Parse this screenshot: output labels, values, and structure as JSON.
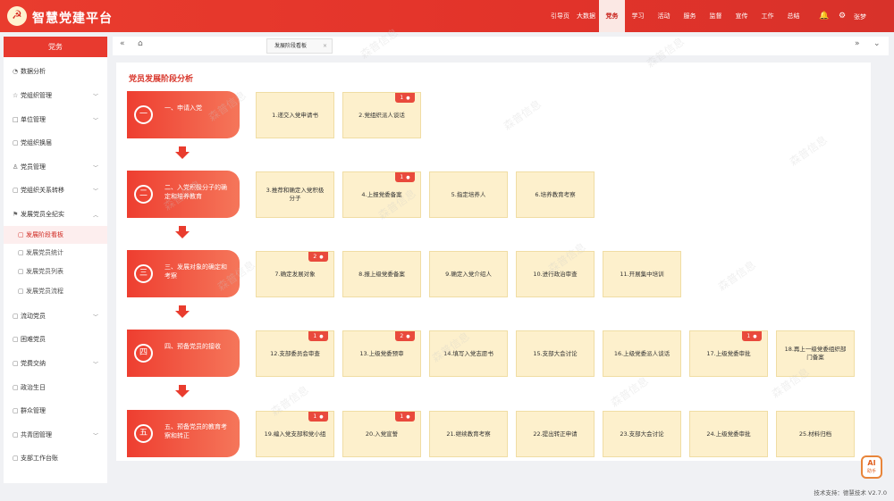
{
  "header": {
    "app_title": "智慧党建平台",
    "nav": [
      "引导页",
      "大数据",
      "党务",
      "学习",
      "活动",
      "服务",
      "监督",
      "宣传",
      "工作",
      "总结"
    ],
    "active_nav": "党务",
    "user_name": "张梦",
    "brand_color": "#e2332a"
  },
  "sidebar": {
    "title": "党务",
    "items": [
      {
        "label": "数据分析",
        "icon": "chart-icon",
        "chevron": false
      },
      {
        "label": "党组织管理",
        "icon": "star-icon",
        "chevron": true
      },
      {
        "label": "单位管理",
        "icon": "building-icon",
        "chevron": true
      },
      {
        "label": "党组织换届",
        "icon": "document-icon",
        "chevron": false
      },
      {
        "label": "党员管理",
        "icon": "user-icon",
        "chevron": true
      },
      {
        "label": "党组织关系转移",
        "icon": "transfer-icon",
        "chevron": true
      },
      {
        "label": "发展党员全纪实",
        "icon": "flag-icon",
        "chevron": true,
        "expanded": true
      },
      {
        "label": "发展阶段看板",
        "icon": "board-icon",
        "sub": true,
        "active": true
      },
      {
        "label": "发展党员统计",
        "icon": "stats-icon",
        "sub": true
      },
      {
        "label": "发展党员列表",
        "icon": "list-icon",
        "sub": true
      },
      {
        "label": "发展党员流程",
        "icon": "flow-icon",
        "sub": true
      },
      {
        "label": "流动党员",
        "icon": "people-icon",
        "chevron": true
      },
      {
        "label": "困难党员",
        "icon": "heart-icon",
        "chevron": false
      },
      {
        "label": "党费交纳",
        "icon": "wallet-icon",
        "chevron": true
      },
      {
        "label": "政治生日",
        "icon": "cake-icon",
        "chevron": false
      },
      {
        "label": "群众管理",
        "icon": "group-icon",
        "chevron": false
      },
      {
        "label": "共青团管理",
        "icon": "team-icon",
        "chevron": true
      },
      {
        "label": "支部工作台账",
        "icon": "ledger-icon",
        "chevron": false
      }
    ]
  },
  "tabs": {
    "active_tab": "发展阶段看板"
  },
  "main": {
    "section_title": "党员发展阶段分析",
    "stages": [
      {
        "num": "一",
        "label": "一、申请入党",
        "steps": [
          {
            "label": "1.递交入党申请书",
            "badge": null
          },
          {
            "label": "2.党组织派人谈话",
            "badge": "1"
          }
        ]
      },
      {
        "num": "二",
        "label": "二、入党积极分子的确定和培养教育",
        "steps": [
          {
            "label": "3.推荐和确定入党积极分子",
            "badge": null
          },
          {
            "label": "4.上报党委备案",
            "badge": "1"
          },
          {
            "label": "5.指定培养人",
            "badge": null
          },
          {
            "label": "6.培养教育考察",
            "badge": null
          }
        ]
      },
      {
        "num": "三",
        "label": "三、发展对象的确定和考察",
        "steps": [
          {
            "label": "7.确定发展对象",
            "badge": "2"
          },
          {
            "label": "8.报上级党委备案",
            "badge": null
          },
          {
            "label": "9.确定入党介绍人",
            "badge": null
          },
          {
            "label": "10.进行政治审查",
            "badge": null
          },
          {
            "label": "11.开展集中培训",
            "badge": null
          }
        ]
      },
      {
        "num": "四",
        "label": "四、预备党员的接收",
        "steps": [
          {
            "label": "12.支部委员会审查",
            "badge": "1"
          },
          {
            "label": "13.上级党委预审",
            "badge": "2"
          },
          {
            "label": "14.填写入党志愿书",
            "badge": null
          },
          {
            "label": "15.支部大会讨论",
            "badge": null
          },
          {
            "label": "16.上级党委派人谈话",
            "badge": null
          },
          {
            "label": "17.上级党委审批",
            "badge": "1"
          },
          {
            "label": "18.再上一级党委组织部门备案",
            "badge": null
          }
        ]
      },
      {
        "num": "五",
        "label": "五、预备党员的教育考察和转正",
        "steps": [
          {
            "label": "19.编入党支部和党小组",
            "badge": "1"
          },
          {
            "label": "20.入党宣誓",
            "badge": "1"
          },
          {
            "label": "21.继续教育考察",
            "badge": null
          },
          {
            "label": "22.提出转正申请",
            "badge": null
          },
          {
            "label": "23.支部大会讨论",
            "badge": null
          },
          {
            "label": "24.上级党委审批",
            "badge": null
          },
          {
            "label": "25.材料归档",
            "badge": null
          }
        ]
      }
    ]
  },
  "footer": {
    "support": "技术支持：德慧技术",
    "version": "V2.7.0"
  },
  "watermark": "森普信息",
  "ai_button": {
    "label": "AI",
    "sub": "助手"
  }
}
